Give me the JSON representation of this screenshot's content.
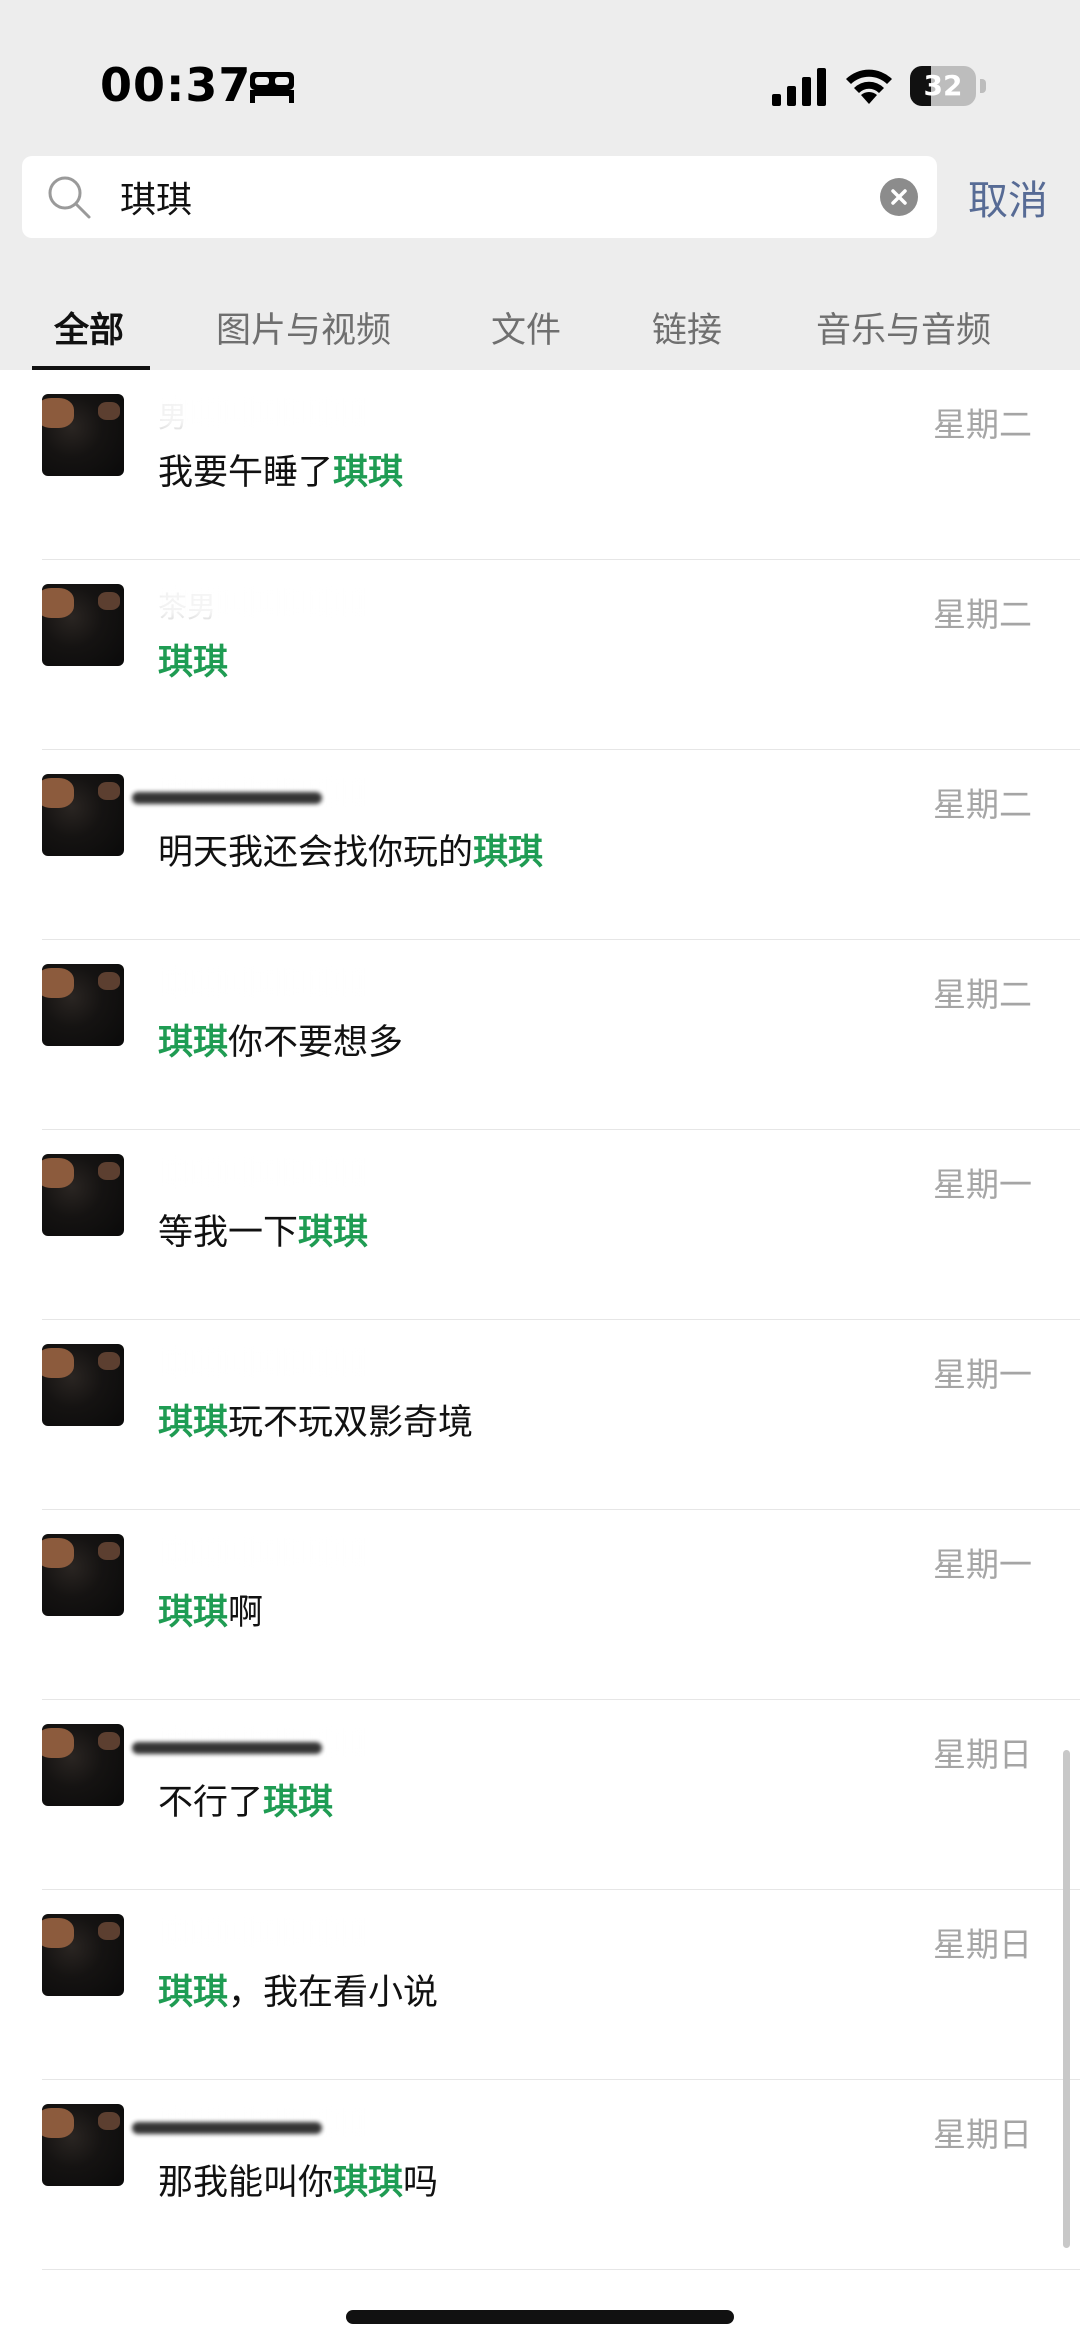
{
  "status_bar": {
    "time": "00:37",
    "focus_icon": "bed-icon",
    "signal_icon": "cellular-signal-icon",
    "wifi_icon": "wifi-icon",
    "battery_level": "32"
  },
  "search": {
    "query": "琪琪",
    "search_icon": "search-icon",
    "clear_icon": "clear-icon",
    "cancel_label": "取消"
  },
  "tabs": [
    {
      "label": "全部",
      "active": true
    },
    {
      "label": "图片与视频",
      "active": false
    },
    {
      "label": "文件",
      "active": false
    },
    {
      "label": "链接",
      "active": false
    },
    {
      "label": "音乐与音频",
      "active": false
    }
  ],
  "results": [
    {
      "sender": "男",
      "segments": [
        {
          "text": "我要午睡了",
          "hl": false
        },
        {
          "text": "琪琪",
          "hl": true
        }
      ],
      "date": "星期二"
    },
    {
      "sender": "茶男",
      "segments": [
        {
          "text": "琪琪",
          "hl": true
        }
      ],
      "date": "星期二"
    },
    {
      "sender": "",
      "segments": [
        {
          "text": "明天我还会找你玩的",
          "hl": false
        },
        {
          "text": "琪琪",
          "hl": true
        }
      ],
      "date": "星期二"
    },
    {
      "sender": "",
      "segments": [
        {
          "text": "琪琪",
          "hl": true
        },
        {
          "text": "你不要想多",
          "hl": false
        }
      ],
      "date": "星期二"
    },
    {
      "sender": "",
      "segments": [
        {
          "text": "等我一下",
          "hl": false
        },
        {
          "text": "琪琪",
          "hl": true
        }
      ],
      "date": "星期一"
    },
    {
      "sender": "",
      "segments": [
        {
          "text": "琪琪",
          "hl": true
        },
        {
          "text": "玩不玩双影奇境",
          "hl": false
        }
      ],
      "date": "星期一"
    },
    {
      "sender": "",
      "segments": [
        {
          "text": "琪琪",
          "hl": true
        },
        {
          "text": "啊",
          "hl": false
        }
      ],
      "date": "星期一"
    },
    {
      "sender": "",
      "segments": [
        {
          "text": "不行了",
          "hl": false
        },
        {
          "text": "琪琪",
          "hl": true
        }
      ],
      "date": "星期日"
    },
    {
      "sender": "",
      "segments": [
        {
          "text": "琪琪",
          "hl": true
        },
        {
          "text": "，我在看小说",
          "hl": false
        }
      ],
      "date": "星期日"
    },
    {
      "sender": "",
      "segments": [
        {
          "text": "那我能叫你",
          "hl": false
        },
        {
          "text": "琪琪",
          "hl": true
        },
        {
          "text": "吗",
          "hl": false
        }
      ],
      "date": "星期日"
    }
  ],
  "colors": {
    "highlight": "#1f9c53",
    "cancel": "#576b95",
    "date": "#a5a5a5",
    "header_bg": "#ededed"
  }
}
